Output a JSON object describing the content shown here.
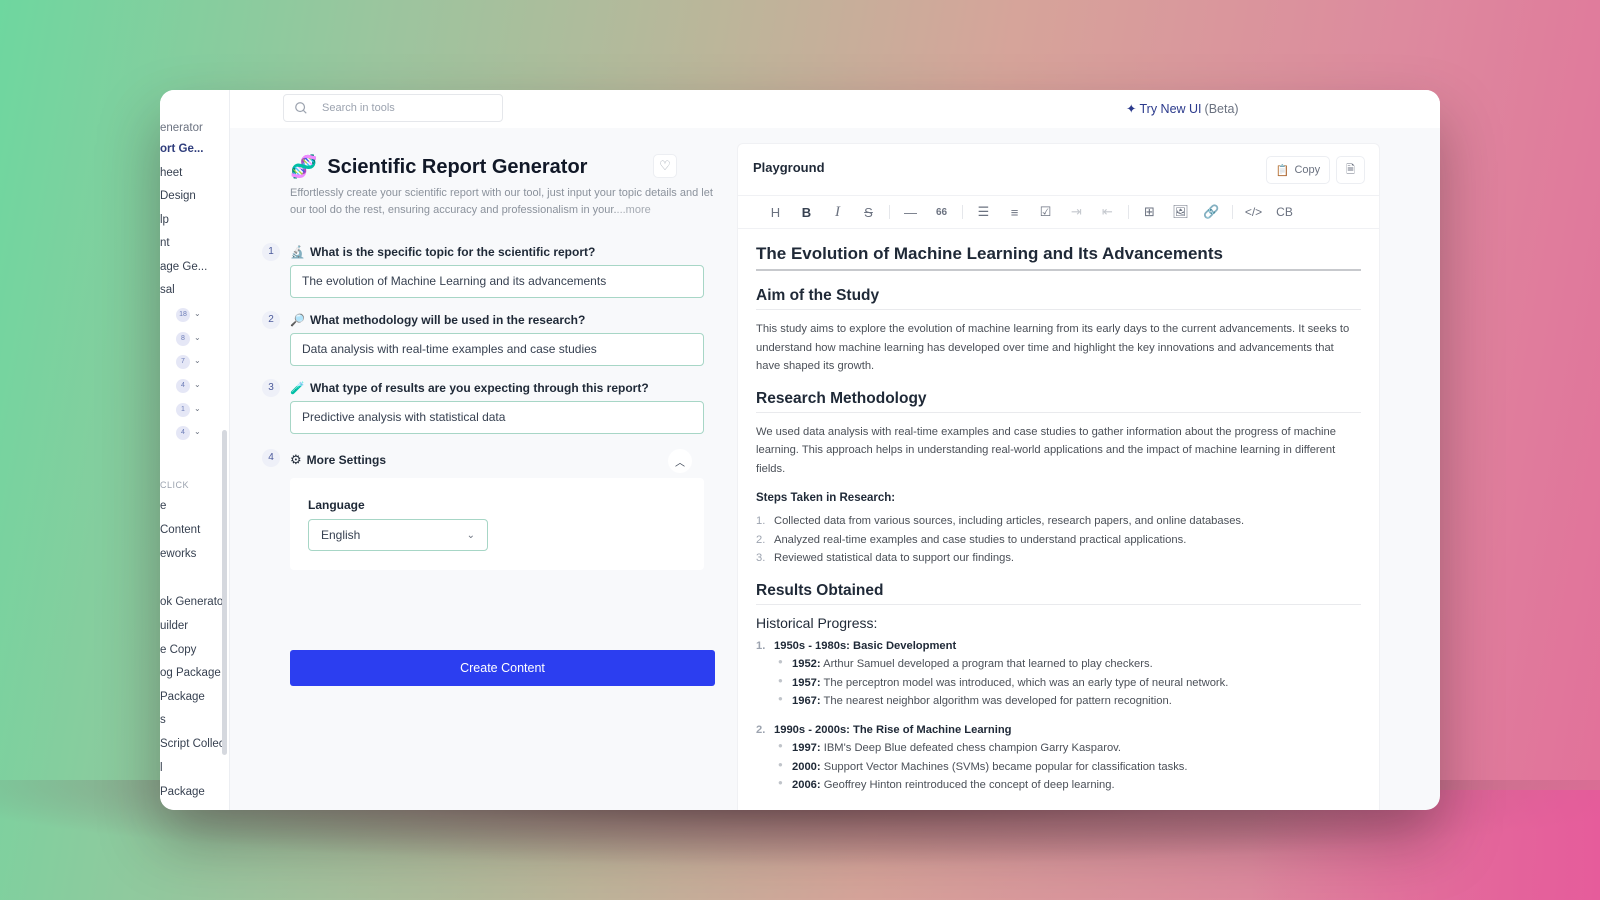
{
  "sidebar": {
    "items": [
      {
        "label": "enerator",
        "active": false
      },
      {
        "label": "ort Ge...",
        "active": true
      },
      {
        "label": "heet",
        "active": false
      },
      {
        "label": "Design",
        "active": false
      },
      {
        "label": "lp",
        "active": false
      },
      {
        "label": "nt",
        "active": false
      },
      {
        "label": "age Ge...",
        "active": false
      },
      {
        "label": "sal",
        "active": false
      }
    ],
    "groups": [
      {
        "count": "18"
      },
      {
        "count": "8"
      },
      {
        "count": "7"
      },
      {
        "count": "4"
      },
      {
        "count": "1"
      },
      {
        "count": "4"
      }
    ],
    "section_label": "CLICK",
    "section_items": [
      "e",
      "Content",
      "eworks",
      "ok Generato",
      "uilder",
      "e Copy",
      "og Package",
      "Package",
      "s",
      "Script Collec",
      "l",
      "Package"
    ]
  },
  "topbar": {
    "search_placeholder": "Search in tools",
    "try_new_label": "Try New UI",
    "try_new_suffix": "(Beta)"
  },
  "tool": {
    "emoji": "🧬",
    "title": "Scientific Report Generator",
    "description": "Effortlessly create your scientific report with our tool, just input your topic details and let our tool do the rest, ensuring accuracy and professionalism in your.",
    "more_label": "...more",
    "questions": [
      {
        "num": "1",
        "emoji": "🔬",
        "label": "What is the specific topic for the scientific report?",
        "value": "The evolution of Machine Learning and its advancements"
      },
      {
        "num": "2",
        "emoji": "🔎",
        "label": "What methodology will be used in the research?",
        "value": "Data analysis with real-time examples and case studies"
      },
      {
        "num": "3",
        "emoji": "🧪",
        "label": "What type of results are you expecting through this report?",
        "value": "Predictive analysis with statistical data"
      }
    ],
    "settings": {
      "num": "4",
      "label": "More Settings",
      "language_label": "Language",
      "language_value": "English"
    },
    "create_label": "Create Content"
  },
  "playground": {
    "title": "Playground",
    "copy_label": "Copy",
    "doc": {
      "h1": "The Evolution of Machine Learning and Its Advancements",
      "aim_heading": "Aim of the Study",
      "aim_text": "This study aims to explore the evolution of machine learning from its early days to the current advancements. It seeks to understand how machine learning has developed over time and highlight the key innovations and advancements that have shaped its growth.",
      "method_heading": "Research Methodology",
      "method_text": "We used data analysis with real-time examples and case studies to gather information about the progress of machine learning. This approach helps in understanding real-world applications and the impact of machine learning in different fields.",
      "steps_heading": "Steps Taken in Research:",
      "steps": [
        "Collected data from various sources, including articles, research papers, and online databases.",
        "Analyzed real-time examples and case studies to understand practical applications.",
        "Reviewed statistical data to support our findings."
      ],
      "results_heading": "Results Obtained",
      "historical_heading": "Historical Progress:",
      "eras": [
        {
          "title": "1950s - 1980s: Basic Development",
          "events": [
            {
              "year": "1952:",
              "text": " Arthur Samuel developed a program that learned to play checkers."
            },
            {
              "year": "1957:",
              "text": " The perceptron model was introduced, which was an early type of neural network."
            },
            {
              "year": "1967:",
              "text": " The nearest neighbor algorithm was developed for pattern recognition."
            }
          ]
        },
        {
          "title": "1990s - 2000s: The Rise of Machine Learning",
          "events": [
            {
              "year": "1997:",
              "text": " IBM's Deep Blue defeated chess champion Garry Kasparov."
            },
            {
              "year": "2000:",
              "text": " Support Vector Machines (SVMs) became popular for classification tasks."
            },
            {
              "year": "2006:",
              "text": " Geoffrey Hinton reintroduced the concept of deep learning."
            }
          ]
        }
      ]
    },
    "toolbar": {
      "heading": "H",
      "bold": "B",
      "italic": "I",
      "strike": "S",
      "hr": "—",
      "quote": "66",
      "code": "</>",
      "codeblock": "CB"
    }
  },
  "colors": {
    "primary": "#2c3ef0",
    "accent_text": "#2b3a8c",
    "input_border": "#a7d6c6"
  }
}
